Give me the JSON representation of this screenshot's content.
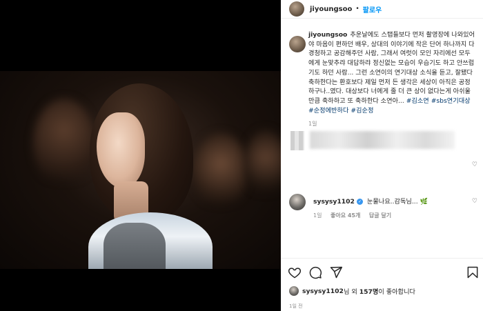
{
  "post": {
    "username": "jiyoungsoo",
    "follow_label": "팔로우",
    "dot": "•"
  },
  "caption": {
    "username": "jiyoungsoo",
    "text": "추운날에도 스탭들보다 먼저 촬영장에 나와있어야 마음이 편하던 배우, 상대의 이야기에 작은 단어 하나까지 다 경청하고 공감해주던 사람, 그래서 여럿이 모인 자리에선 모두에게 눈맞추랴 대답하랴 정신없는 모습이 우습기도 하고 안쓰럽기도 하던 사람... 그런 소연이의 연기대상 소식을 듣고, 잘됐다 축하한다는 환호보다 제일 먼저 든 생각은 세상이 아직은 공정하구나..였다. 대상보다 너에게 줄 더 큰 상이 없다는게 아쉬울만큼 축하하고 또 축하한다 소연아...",
    "hashtags": [
      "#김소연",
      "#sbs연기대상",
      "#순정에반하다",
      "#김순정"
    ],
    "time": "1일"
  },
  "comment2": {
    "username": "sysysy1102",
    "text": "눈물나요..감독님...",
    "emoji": "🌿",
    "time": "1일",
    "likes": "좋아요 45개",
    "reply": "답글 달기"
  },
  "likes": {
    "username": "sysysy1102",
    "mid": "님 외 ",
    "count": "157명",
    "suffix": "이 좋아합니다"
  },
  "post_time": "1일 전",
  "icons": [
    "heart-icon",
    "comment-icon",
    "share-icon",
    "bookmark-icon",
    "verified-icon"
  ]
}
